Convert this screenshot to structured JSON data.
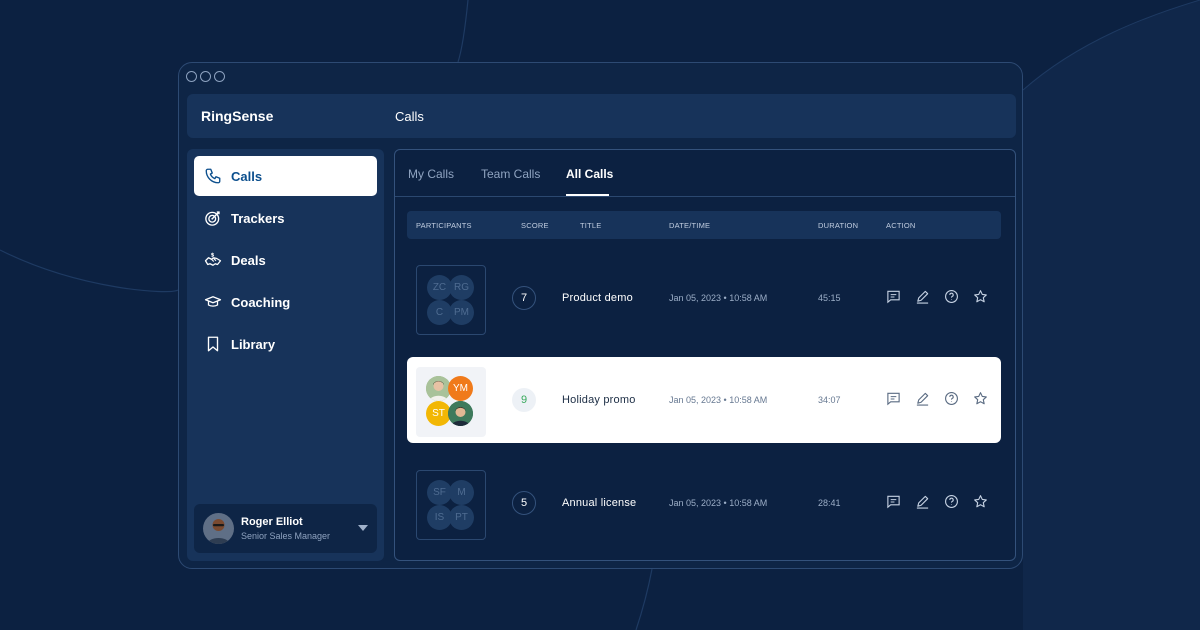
{
  "app": {
    "brand": "RingSense",
    "page_title": "Calls"
  },
  "sidebar": {
    "items": [
      {
        "label": "Calls",
        "icon": "phone-icon",
        "active": true
      },
      {
        "label": "Trackers",
        "icon": "target-icon",
        "active": false
      },
      {
        "label": "Deals",
        "icon": "handshake-icon",
        "active": false
      },
      {
        "label": "Coaching",
        "icon": "graduation-cap-icon",
        "active": false
      },
      {
        "label": "Library",
        "icon": "bookmark-icon",
        "active": false
      }
    ]
  },
  "user": {
    "name": "Roger Elliot",
    "role": "Senior Sales Manager"
  },
  "tabs": [
    {
      "label": "My Calls",
      "active": false
    },
    {
      "label": "Team Calls",
      "active": false
    },
    {
      "label": "All Calls",
      "active": true
    }
  ],
  "table": {
    "columns": [
      "PARTICIPANTS",
      "SCORE",
      "TITLE",
      "DATE/TIME",
      "DURATION",
      "ACTION"
    ],
    "rows": [
      {
        "participants": [
          "ZC",
          "RG",
          "C",
          "PM"
        ],
        "score": "7",
        "title": "Product demo",
        "datetime": "Jan 05, 2023 • 10:58 AM",
        "duration": "45:15",
        "highlighted": false
      },
      {
        "participants": [
          "",
          "YM",
          "ST",
          ""
        ],
        "score": "9",
        "title": "Holiday promo",
        "datetime": "Jan 05, 2023 • 10:58 AM",
        "duration": "34:07",
        "highlighted": true
      },
      {
        "participants": [
          "SF",
          "M",
          "IS",
          "PT"
        ],
        "score": "5",
        "title": "Annual license",
        "datetime": "Jan 05, 2023 • 10:58 AM",
        "duration": "28:41",
        "highlighted": false
      }
    ],
    "actions": [
      "comment-icon",
      "edit-icon",
      "help-icon",
      "star-icon"
    ]
  },
  "colors": {
    "background": "#0c2141",
    "panel": "#17335a",
    "active_nav_text": "#0c4f8d",
    "score_good": "#36a85a",
    "avatar_orange": "#f07a1a",
    "avatar_yellow": "#f2b705"
  }
}
